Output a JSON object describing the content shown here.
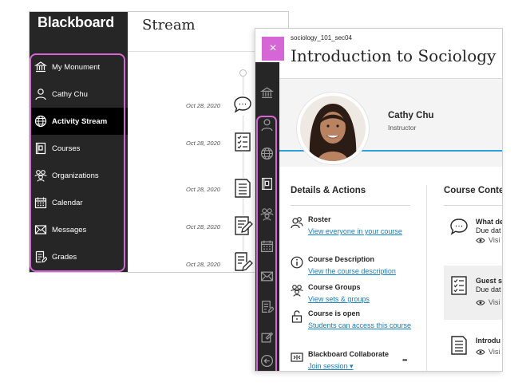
{
  "back_window": {
    "brand": "Blackboard",
    "title": "Stream",
    "nav": [
      {
        "label": "My Monument",
        "icon": "institution-icon"
      },
      {
        "label": "Cathy Chu",
        "icon": "user-icon"
      },
      {
        "label": "Activity Stream",
        "icon": "globe-icon",
        "active": true
      },
      {
        "label": "Courses",
        "icon": "courses-icon"
      },
      {
        "label": "Organizations",
        "icon": "organizations-icon"
      },
      {
        "label": "Calendar",
        "icon": "calendar-icon"
      },
      {
        "label": "Messages",
        "icon": "messages-icon"
      },
      {
        "label": "Grades",
        "icon": "grades-icon"
      }
    ],
    "stream_dates": [
      "Oct 28, 2020",
      "Oct 28, 2020",
      "Oct 28, 2020",
      "Oct 28, 2020",
      "Oct 28, 2020"
    ],
    "highlight_color": "#d665d6"
  },
  "front_window": {
    "close_icon": "×",
    "course_code": "sociology_101_sec04",
    "course_title": "Introduction to Sociology",
    "instructor": {
      "name": "Cathy Chu",
      "role": "Instructor"
    },
    "details_heading": "Details & Actions",
    "content_heading": "Course Conte",
    "details": [
      {
        "title": "Roster",
        "link": "View everyone in your course",
        "icon": "roster-icon"
      },
      {
        "title": "Course Description",
        "link": "View the course description",
        "icon": "info-icon"
      },
      {
        "title": "Course Groups",
        "link": "View sets & groups",
        "icon": "groups-icon"
      },
      {
        "title": "Course is open",
        "link": "Students can access this course",
        "icon": "unlock-icon"
      },
      {
        "title": "Blackboard Collaborate",
        "link": "Join session ▾",
        "more": "•••",
        "icon": "collaborate-icon"
      }
    ],
    "content": [
      {
        "line1": "What de",
        "line2": "Due dat",
        "vis": "Visi",
        "icon": "discussion-icon"
      },
      {
        "line1": "Guest s",
        "line2": "Due dat",
        "vis": "Visi",
        "icon": "assignment-icon"
      },
      {
        "line1": "Introdu",
        "line2": "",
        "vis": "Visi",
        "icon": "document-icon"
      }
    ],
    "accent_color": "#2e9fd8"
  }
}
